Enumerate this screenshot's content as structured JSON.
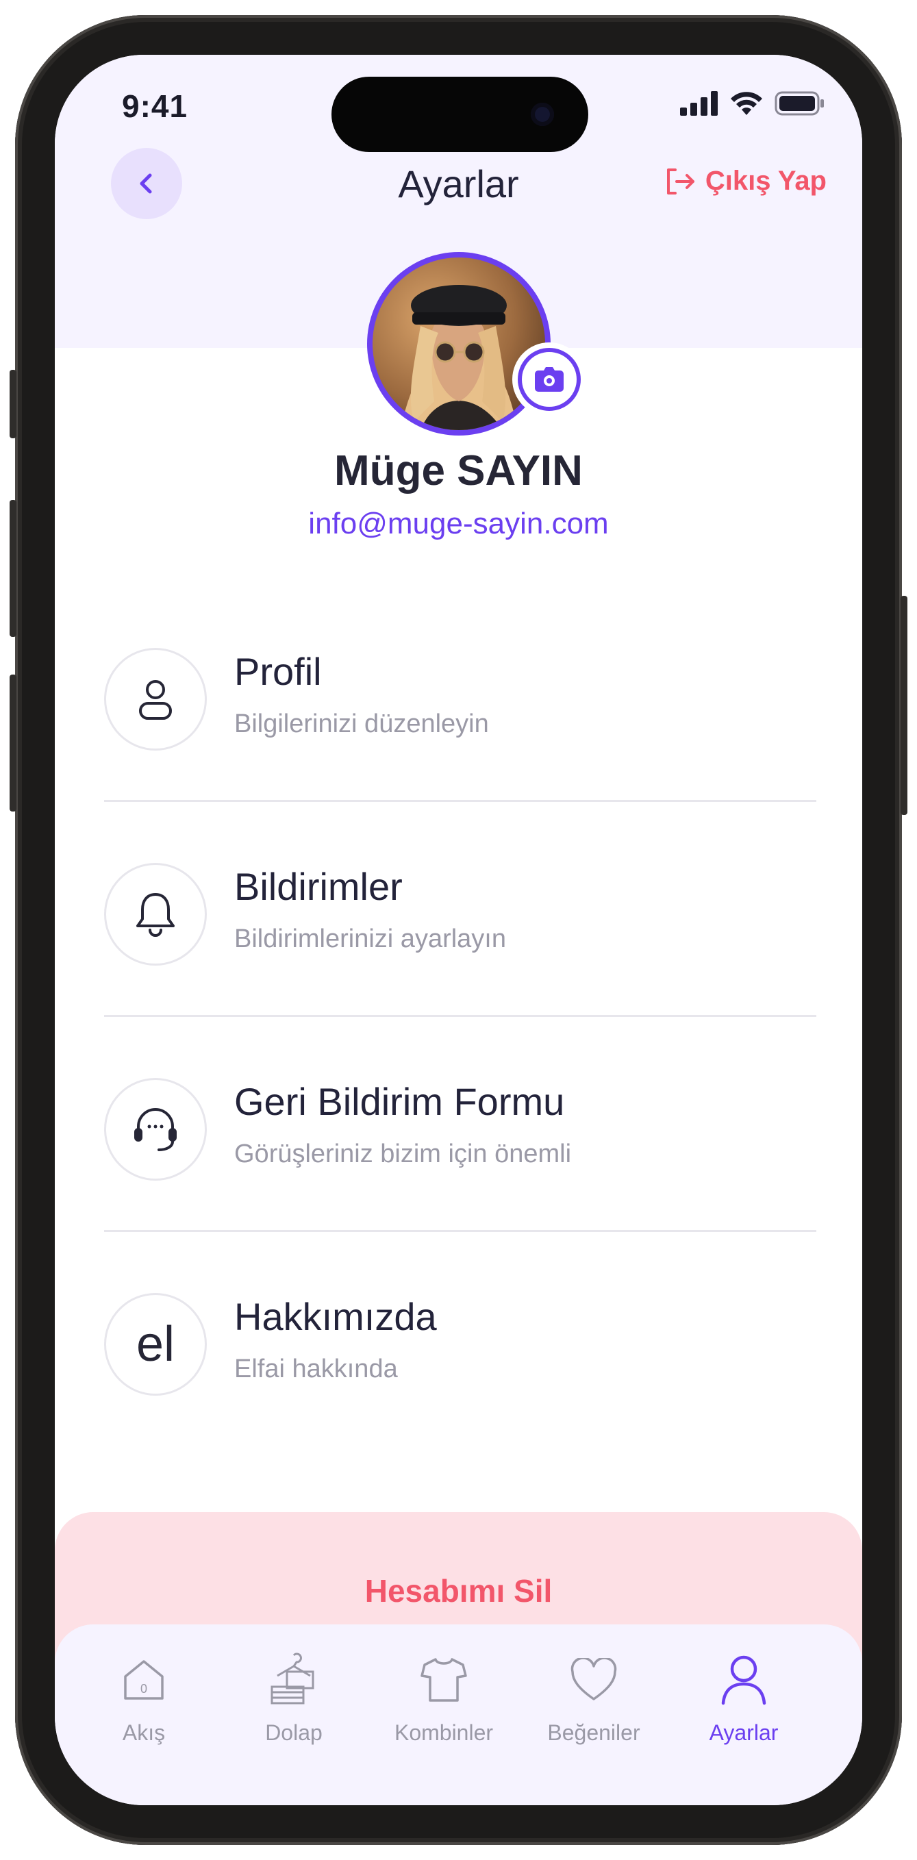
{
  "status_bar": {
    "time": "9:41"
  },
  "header": {
    "title": "Ayarlar",
    "logout_label": "Çıkış Yap"
  },
  "profile": {
    "name": "Müge SAYIN",
    "email": "info@muge-sayin.com"
  },
  "menu": [
    {
      "title": "Profil",
      "subtitle": "Bilgilerinizi düzenleyin",
      "icon": "user-icon"
    },
    {
      "title": "Bildirimler",
      "subtitle": "Bildirimlerinizi ayarlayın",
      "icon": "bell-icon"
    },
    {
      "title": "Geri Bildirim Formu",
      "subtitle": "Görüşleriniz bizim için önemli",
      "icon": "headset-icon"
    },
    {
      "title": "Hakkımızda",
      "subtitle": "Elfai hakkında",
      "icon": "el-logo",
      "icon_text": "el"
    }
  ],
  "delete_account_label": "Hesabımı Sil",
  "tabs": [
    {
      "label": "Akış",
      "icon": "home-icon",
      "badge": "0"
    },
    {
      "label": "Dolap",
      "icon": "wardrobe-icon"
    },
    {
      "label": "Kombinler",
      "icon": "tshirt-icon"
    },
    {
      "label": "Beğeniler",
      "icon": "heart-icon"
    },
    {
      "label": "Ayarlar",
      "icon": "user-icon",
      "active": true
    }
  ],
  "colors": {
    "accent": "#6b3ff0",
    "danger": "#f2566a",
    "header_bg": "#f6f3ff",
    "danger_bg": "#fde0e5",
    "text": "#23233a",
    "muted": "#9a99a6"
  }
}
